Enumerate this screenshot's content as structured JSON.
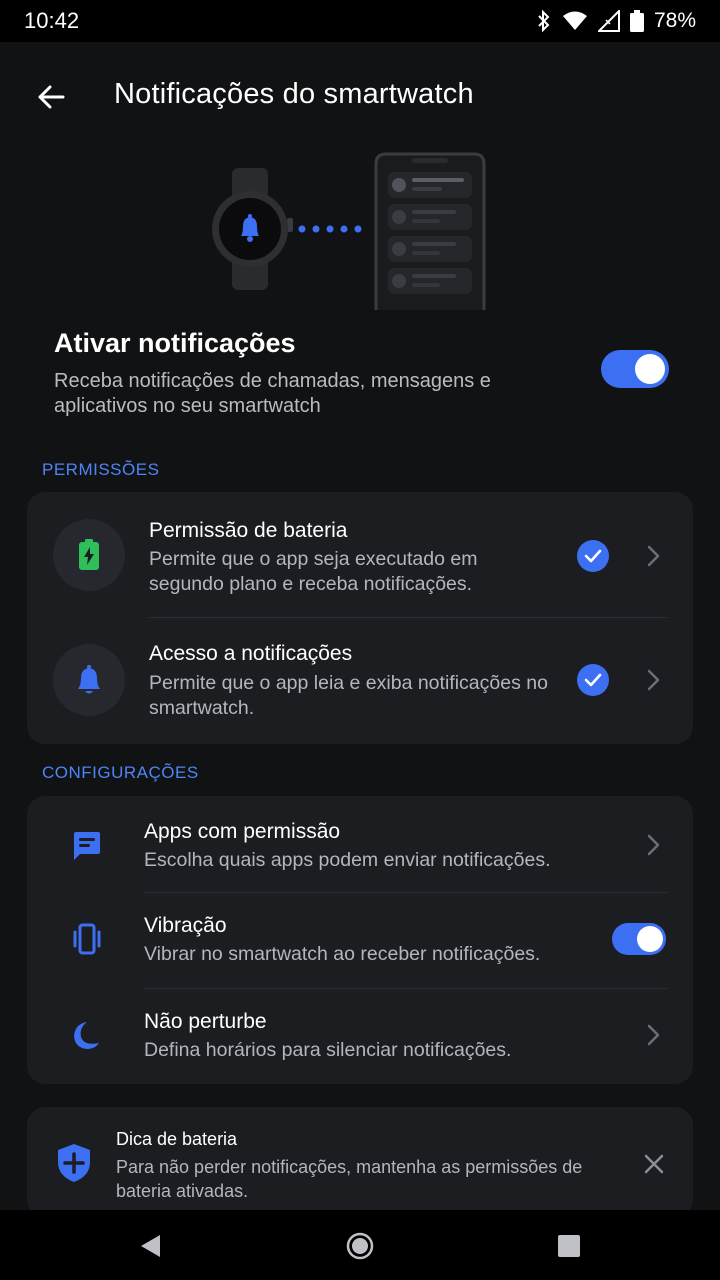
{
  "status_bar": {
    "time": "10:42",
    "battery": "78%"
  },
  "app_bar": {
    "title": "Notificações do smartwatch"
  },
  "main_toggle": {
    "title": "Ativar notificações",
    "description": "Receba notificações de chamadas, mensagens e aplicativos no seu smartwatch",
    "enabled": true
  },
  "permissions": {
    "label": "PERMISSÕES",
    "items": [
      {
        "title": "Permissão de bateria",
        "description": "Permite que o app seja executado em segundo plano e receba notificações.",
        "granted": true,
        "icon": "battery-charging-icon"
      },
      {
        "title": "Acesso a notificações",
        "description": "Permite que o app leia e exiba notificações no smartwatch.",
        "granted": true,
        "icon": "bell-icon"
      }
    ]
  },
  "settings": {
    "label": "CONFIGURAÇÕES",
    "items": [
      {
        "title": "Apps com permissão",
        "description": "Escolha quais apps podem enviar notificações.",
        "icon": "message-icon"
      },
      {
        "title": "Vibração",
        "description": "Vibrar no smartwatch ao receber notificações.",
        "icon": "vibration-icon",
        "enabled": true
      },
      {
        "title": "Não perturbe",
        "description": "Defina horários para silenciar notificações.",
        "icon": "moon-icon"
      }
    ]
  },
  "tip": {
    "title": "Dica de bateria",
    "description": "Para não perder notificações, mantenha as permissões de bateria ativadas.",
    "icon": "shield-plus-icon"
  },
  "colors": {
    "accent": "#3d6ff2",
    "label": "#4f84f6",
    "battery_green": "#2fbf5a",
    "background": "#111214",
    "card": "#1c1d21"
  }
}
